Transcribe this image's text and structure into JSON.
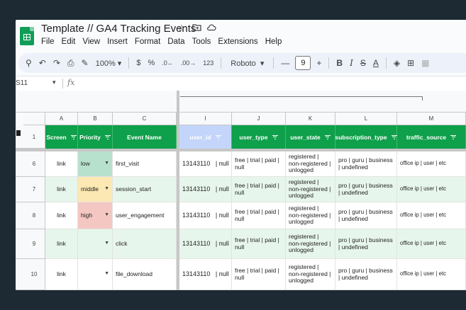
{
  "document": {
    "title": "Template // GA4 Tracking Events"
  },
  "icons": {
    "star": "star-icon",
    "folder": "move-to-folder-icon",
    "cloud": "cloud-status-icon"
  },
  "menu": [
    "File",
    "Edit",
    "View",
    "Insert",
    "Format",
    "Data",
    "Tools",
    "Extensions",
    "Help"
  ],
  "toolbar": {
    "zoom": "100%",
    "currency": "$",
    "percent": "%",
    "decrease_decimal": ".0←",
    "increase_decimal": ".00→",
    "number_format": "123",
    "font": "Roboto",
    "font_size": "9",
    "bold": "B",
    "italic": "I",
    "strikethrough": "S",
    "text_color": "A"
  },
  "formula_bar": {
    "cell_ref": "S11",
    "fx": "fx"
  },
  "colors": {
    "header_green": "#0ea04a",
    "row_tint": "#e7f6ec",
    "low": "#b7e1cd",
    "middle": "#fce8b2",
    "high": "#f4c7c3",
    "selected_header": "#c3d5fa"
  },
  "columns": [
    "A",
    "B",
    "C",
    "I",
    "J",
    "K",
    "L",
    "M"
  ],
  "header_row": {
    "number": "1",
    "cells": [
      "Screen",
      "Priority",
      "Event Name",
      "user_id",
      "user_type",
      "user_state",
      "subscription_type",
      "traffic_source"
    ]
  },
  "rows": [
    {
      "number": "6",
      "screen": "link",
      "priority": "low",
      "event": "first_visit",
      "user_id": "13143110   | null",
      "user_type": "free | trial | paid | null",
      "user_state": "registered | non-registered | unlogged",
      "subscription_type": "pro | guru | business | undefined",
      "traffic_source": "office ip | user | etc"
    },
    {
      "number": "7",
      "screen": "link",
      "priority": "middle",
      "event": "session_start",
      "user_id": "13143110   | null",
      "user_type": "free | trial | paid | null",
      "user_state": "registered | non-registered | unlogged",
      "subscription_type": "pro | guru | business | undefined",
      "traffic_source": "office ip | user | etc"
    },
    {
      "number": "8",
      "screen": "link",
      "priority": "high",
      "event": "user_engagement",
      "user_id": "13143110   | null",
      "user_type": "free | trial | paid | null",
      "user_state": "registered | non-registered | unlogged",
      "subscription_type": "pro | guru | business | undefined",
      "traffic_source": "office ip | user | etc"
    },
    {
      "number": "9",
      "screen": "link",
      "priority": "",
      "event": "click",
      "user_id": "13143110   | null",
      "user_type": "free | trial | paid | null",
      "user_state": "registered | non-registered | unlogged",
      "subscription_type": "pro | guru | business | undefined",
      "traffic_source": "office ip | user | etc"
    },
    {
      "number": "10",
      "screen": "link",
      "priority": "",
      "event": "file_download",
      "user_id": "13143110   | null",
      "user_type": "free | trial | paid | null",
      "user_state": "registered | non-registered | unlogged",
      "subscription_type": "pro | guru | business | undefined",
      "traffic_source": "office ip | user | etc"
    }
  ]
}
